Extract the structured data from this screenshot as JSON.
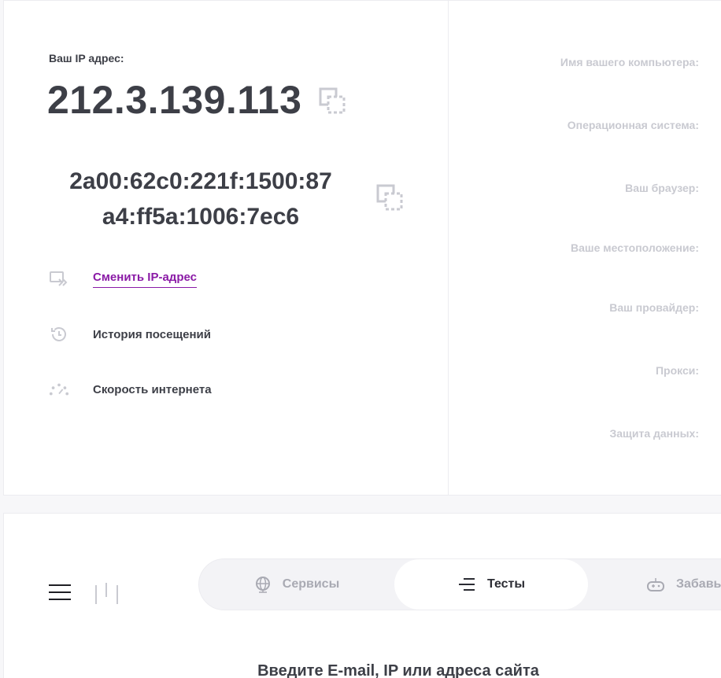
{
  "ip": {
    "label": "Ваш IP адрес:",
    "v4": "212.3.139.113",
    "v6_line1": "2a00:62c0:221f:1500:87",
    "v6_line2": "a4:ff5a:1006:7ec6"
  },
  "actions": [
    {
      "label": "Сменить IP-адрес",
      "icon": "change-ip-icon"
    },
    {
      "label": "История посещений",
      "icon": "history-icon"
    },
    {
      "label": "Скорость интернета",
      "icon": "speedometer-icon"
    }
  ],
  "info": {
    "computer_name": "Имя вашего компьютера:",
    "os": "Операционная система:",
    "browser": "Ваш браузер:",
    "location": "Ваше местоположение:",
    "provider": "Ваш провайдер:",
    "proxy": "Прокси:",
    "protection": "Защита данных:"
  },
  "tabs": [
    {
      "label": "Сервисы",
      "icon": "globe-icon",
      "active": false
    },
    {
      "label": "Тесты",
      "icon": "list-lines-icon",
      "active": true
    },
    {
      "label": "Забавы",
      "icon": "gamepad-icon",
      "active": false
    }
  ],
  "bottom": {
    "heading": "Введите E-mail, IP или адреса сайта"
  },
  "colors": {
    "link": "#8a1aa6",
    "text_dark": "#3d3f47",
    "text_muted": "#c9cad1"
  }
}
